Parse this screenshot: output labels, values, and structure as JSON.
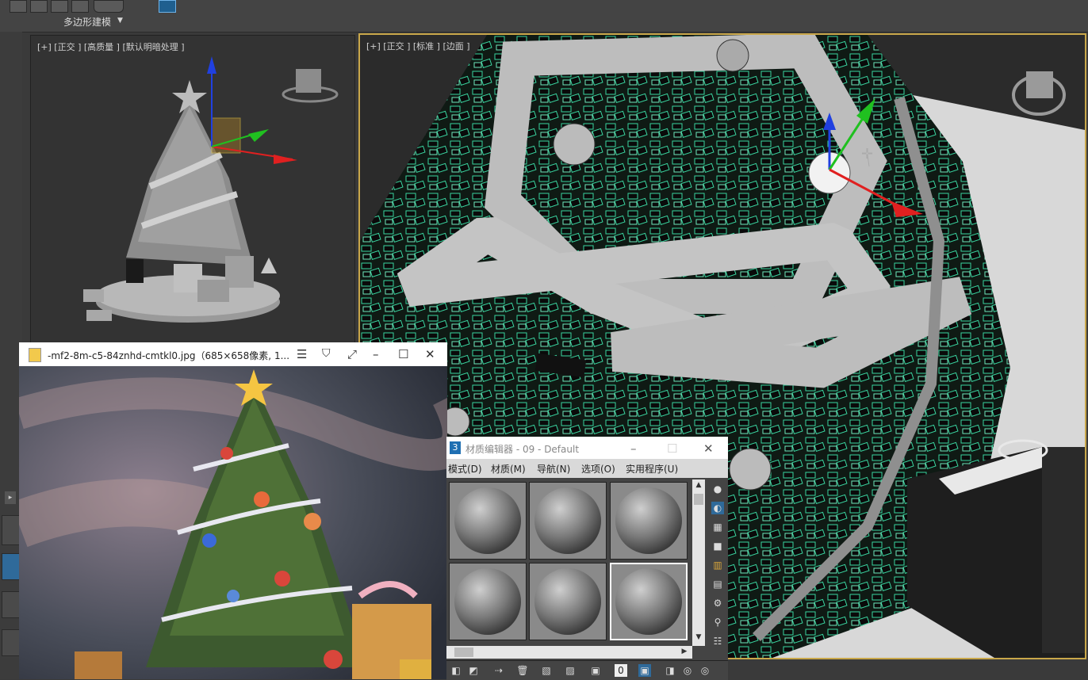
{
  "ribbon": {
    "panel_label": "多边形建模"
  },
  "viewports": {
    "left": {
      "label": "[+] [正交 ] [高质量 ] [默认明暗处理 ]"
    },
    "right": {
      "label": "[+] [正交 ] [标准 ] [边面 ]"
    }
  },
  "image_viewer": {
    "title": "-mf2-8m-c5-84znhd-cmtkl0.jpg（685×658像素, 1..."
  },
  "material_editor": {
    "title_num": "3",
    "title": "材质编辑器 - 09 - Default",
    "menu": [
      "模式(D)",
      "材质(M)",
      "导航(N)",
      "选项(O)",
      "实用程序(U)"
    ]
  },
  "colors": {
    "selection_wire": "#39d6a0",
    "viewport_active_border": "#c9a74a",
    "axis_x": "#e02020",
    "axis_y": "#20c020",
    "axis_z": "#2040e0"
  }
}
